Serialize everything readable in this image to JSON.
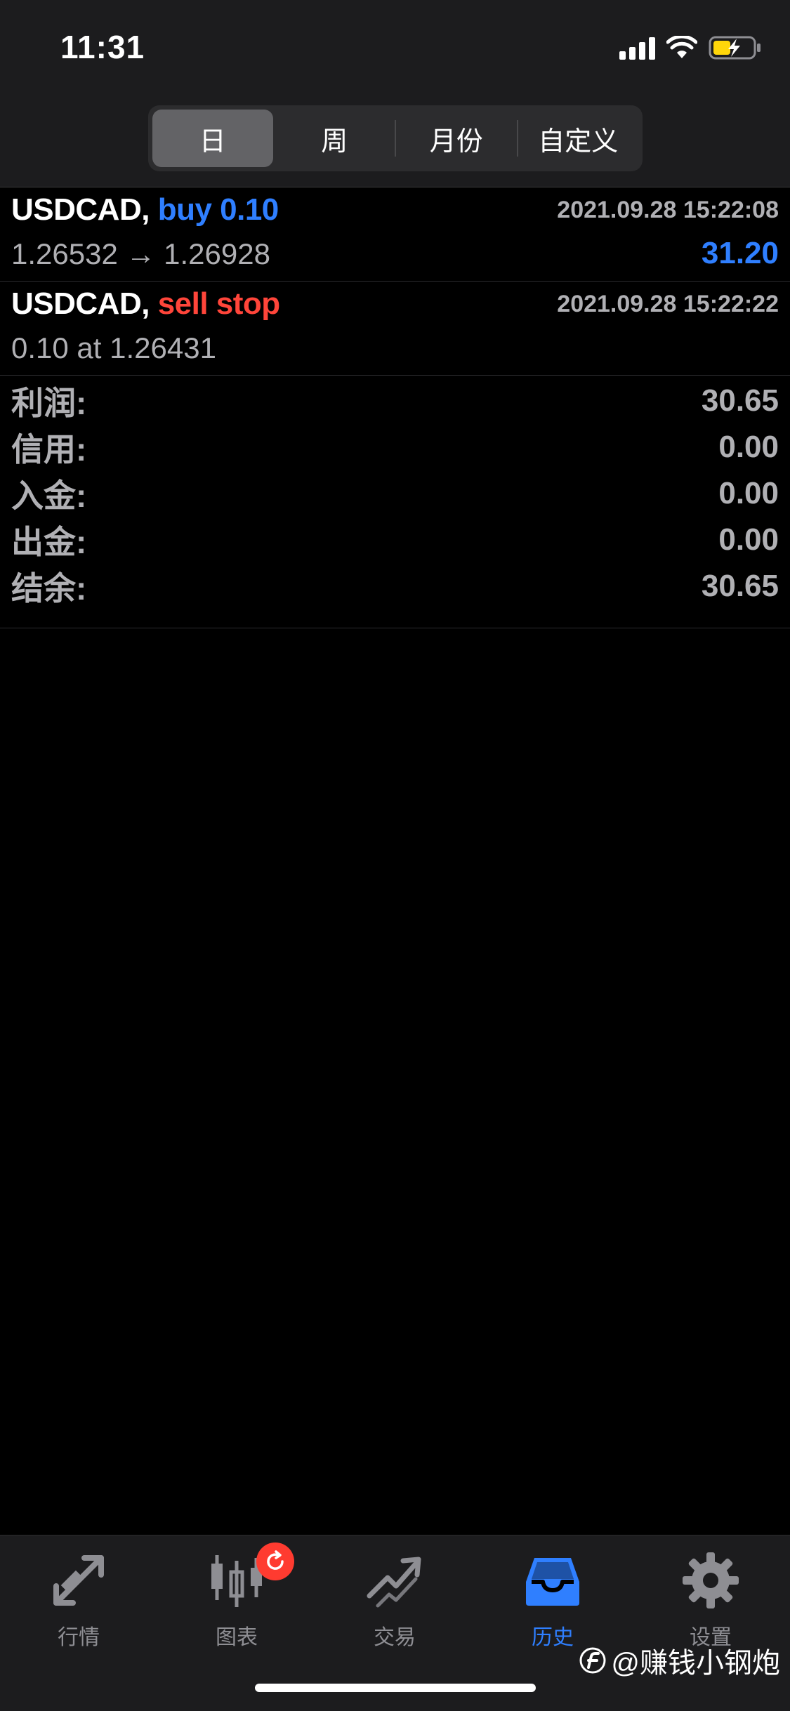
{
  "status_bar": {
    "time": "11:31"
  },
  "period_tabs": [
    {
      "label": "日",
      "active": true
    },
    {
      "label": "周",
      "active": false
    },
    {
      "label": "月份",
      "active": false
    },
    {
      "label": "自定义",
      "active": false
    }
  ],
  "history": [
    {
      "symbol": "USDCAD,",
      "type": "buy 0.10",
      "type_color": "#2f7fff",
      "timestamp": "2021.09.28 15:22:08",
      "detail": "1.26532 → 1.26928",
      "profit": "31.20"
    },
    {
      "symbol": "USDCAD,",
      "type": "sell stop",
      "type_color": "#ff453a",
      "timestamp": "2021.09.28 15:22:22",
      "detail": "0.10 at 1.26431",
      "profit": ""
    }
  ],
  "summary": [
    {
      "label": "利润:",
      "value": "30.65"
    },
    {
      "label": "信用:",
      "value": "0.00"
    },
    {
      "label": "入金:",
      "value": "0.00"
    },
    {
      "label": "出金:",
      "value": "0.00"
    },
    {
      "label": "结余:",
      "value": "30.65"
    }
  ],
  "tabbar": [
    {
      "label": "行情",
      "icon": "quotes-icon",
      "active": false
    },
    {
      "label": "图表",
      "icon": "chart-icon",
      "active": false,
      "badge": true
    },
    {
      "label": "交易",
      "icon": "trade-icon",
      "active": false
    },
    {
      "label": "历史",
      "icon": "history-inbox-icon",
      "active": true
    },
    {
      "label": "设置",
      "icon": "gear-icon",
      "active": false
    }
  ],
  "watermark": "@赚钱小钢炮",
  "colors": {
    "accent": "#2f7fff",
    "sell": "#ff453a",
    "badge": "#ff3b30"
  }
}
